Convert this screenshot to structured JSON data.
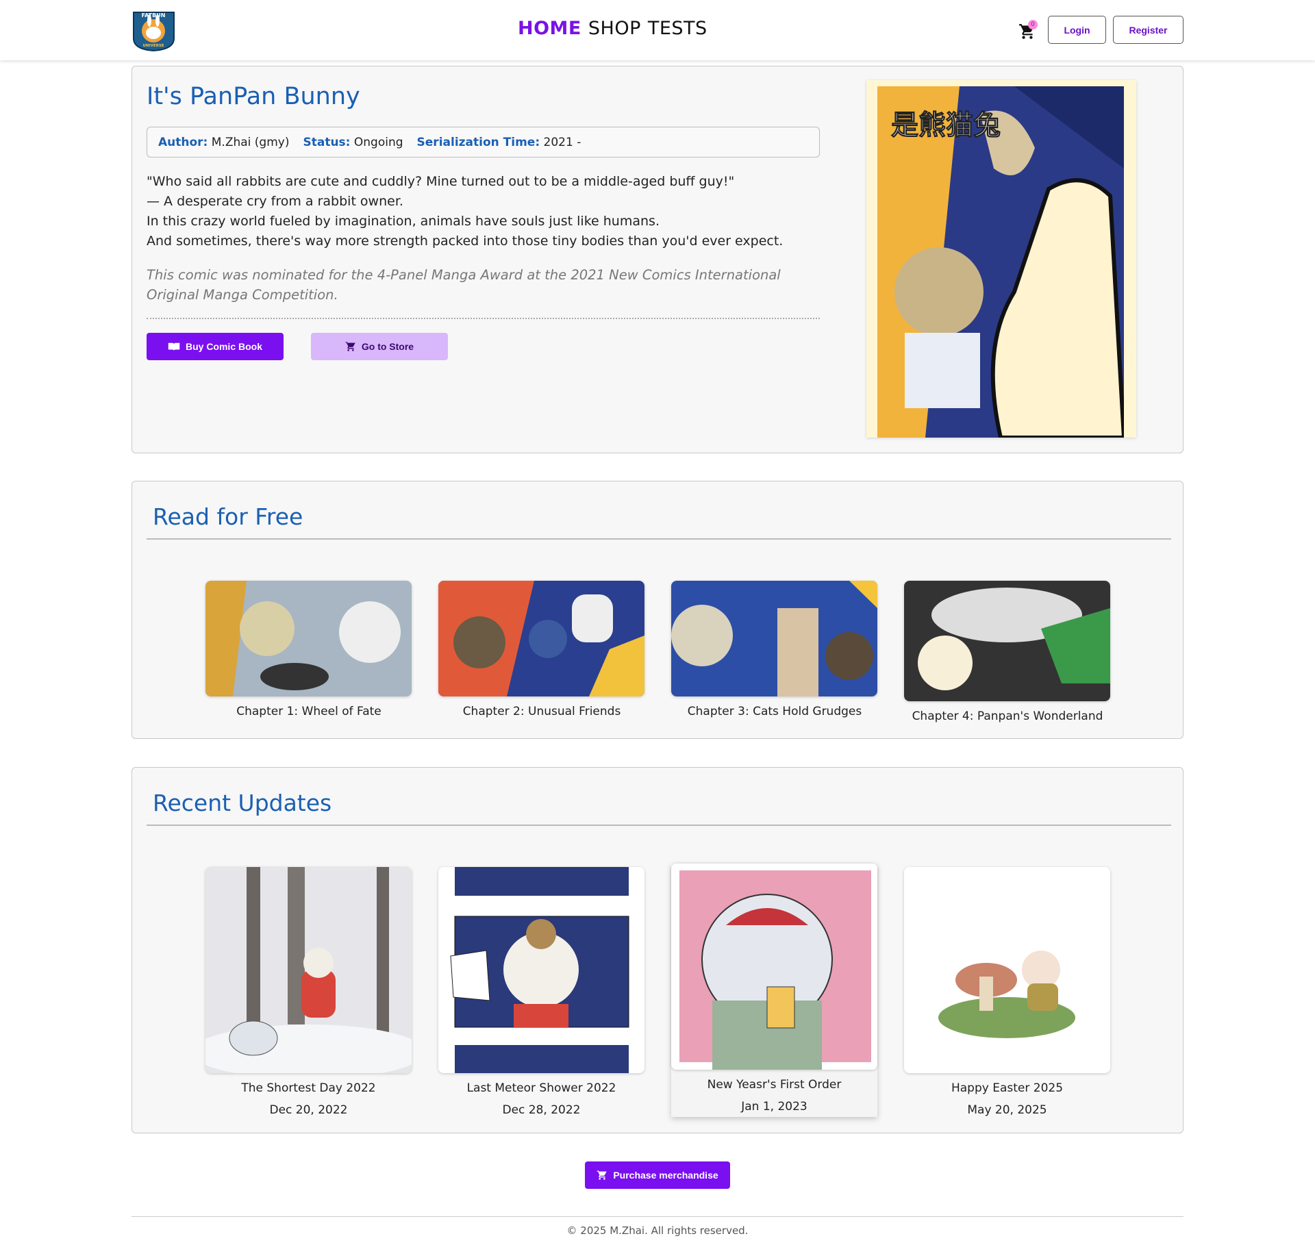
{
  "header": {
    "logo_text_top": "FATBUN",
    "logo_text_bottom": "UNIVERSE",
    "nav": [
      {
        "label": "HOME",
        "active": true
      },
      {
        "label": "SHOP",
        "active": false
      },
      {
        "label": "TESTS",
        "active": false
      }
    ],
    "cart_count": "0",
    "login_label": "Login",
    "register_label": "Register"
  },
  "hero": {
    "title": "It's PanPan Bunny",
    "author_label": "Author:",
    "author_value": "M.Zhai (gmy)",
    "status_label": "Status:",
    "status_value": "Ongoing",
    "serial_label": "Serialization Time:",
    "serial_value": "2021 -",
    "description": [
      "\"Who said all rabbits are cute and cuddly? Mine turned out to be a middle-aged buff guy!\"",
      "— A desperate cry from a rabbit owner.",
      "In this crazy world fueled by imagination, animals have souls just like humans.",
      "And sometimes, there's way more strength packed into those tiny bodies than you'd ever expect."
    ],
    "award": "This comic was nominated for the 4-Panel Manga Award at the 2021 New Comics International Original Manga Competition.",
    "buy_label": "Buy Comic Book",
    "store_label": "Go to Store",
    "cover_title_chars": "是熊猫兔"
  },
  "free": {
    "title": "Read for Free",
    "chapters": [
      {
        "caption": "Chapter 1: Wheel of Fate"
      },
      {
        "caption": "Chapter 2: Unusual Friends"
      },
      {
        "caption": "Chapter 3: Cats Hold Grudges"
      },
      {
        "caption": "Chapter 4: Panpan's Wonderland"
      }
    ]
  },
  "updates": {
    "title": "Recent Updates",
    "items": [
      {
        "title": "The Shortest Day 2022",
        "date": "Dec 20, 2022"
      },
      {
        "title": "Last Meteor Shower 2022",
        "date": "Dec 28, 2022"
      },
      {
        "title": "New Yeasr's First Order",
        "date": "Jan 1, 2023"
      },
      {
        "title": "Happy Easter 2025",
        "date": "May 20, 2025"
      }
    ]
  },
  "merch_label": "Purchase merchandise",
  "footer": "© 2025 M.Zhai. All rights reserved.",
  "colors": {
    "accent": "#7a0ff0",
    "title_blue": "#1a5fb4",
    "store_btn": "#d9b7fb"
  }
}
